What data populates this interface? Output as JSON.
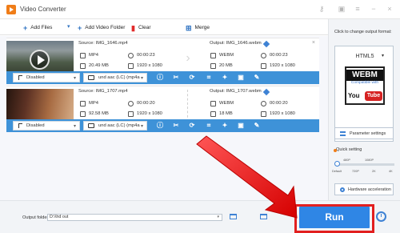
{
  "app": {
    "title": "Video Converter",
    "window_icons": [
      "key-icon",
      "cart-icon",
      "menu-icon",
      "minimize-icon",
      "close-icon"
    ]
  },
  "toolbar": {
    "add_files": "Add Files",
    "add_folder": "Add Video Folder",
    "clear": "Clear",
    "merge": "Merge"
  },
  "files": [
    {
      "source": "Source: IMG_1646.mp4",
      "input_format": "MP4",
      "input_duration": "00:00:23",
      "input_size": "20.49 MB",
      "input_resolution": "1920 x 1080",
      "output": "Output: IMG_1646.webm",
      "output_format": "WEBM",
      "output_duration": "00:00:23",
      "output_size": "20 MB",
      "output_resolution": "1920 x 1080",
      "subtitle": "Disabled",
      "audio": "und aac (LC) (mp4a"
    },
    {
      "source": "Source: IMG_1707.mp4",
      "input_format": "MP4",
      "input_duration": "00:00:20",
      "input_size": "92.58 MB",
      "input_resolution": "1920 x 1080",
      "output": "Output: IMG_1707.webm",
      "output_format": "WEBM",
      "output_duration": "00:00:20",
      "output_size": "18 MB",
      "output_resolution": "1920 x 1080",
      "subtitle": "Disabled",
      "audio": "und aac (LC) (mp4a"
    }
  ],
  "edit_tools": [
    "info-icon",
    "trim-icon",
    "rotate-icon",
    "crop-icon",
    "effects-icon",
    "watermark-icon",
    "subtitle-edit-icon"
  ],
  "right_panel": {
    "hint": "Click to change output format:",
    "format": "HTML5",
    "webm_logo": "WEBM",
    "compatible": "Compatible with",
    "you": "You",
    "tube": "Tube",
    "parameter_settings": "Parameter settings",
    "quick_setting": "Quick setting",
    "speed_levels": [
      "480P",
      "1080P",
      "Default",
      "720P",
      "2K",
      "4K"
    ],
    "quick_setting_value": 0,
    "hardware_acceleration": "Hardware acceleration"
  },
  "bottom": {
    "output_folder_label": "Output folder:",
    "output_folder_value": "D:\\\\hd out",
    "run": "Run"
  },
  "colors": {
    "accent": "#3e92d8",
    "run": "#2f86e5",
    "annotation": "#e21f1f"
  }
}
